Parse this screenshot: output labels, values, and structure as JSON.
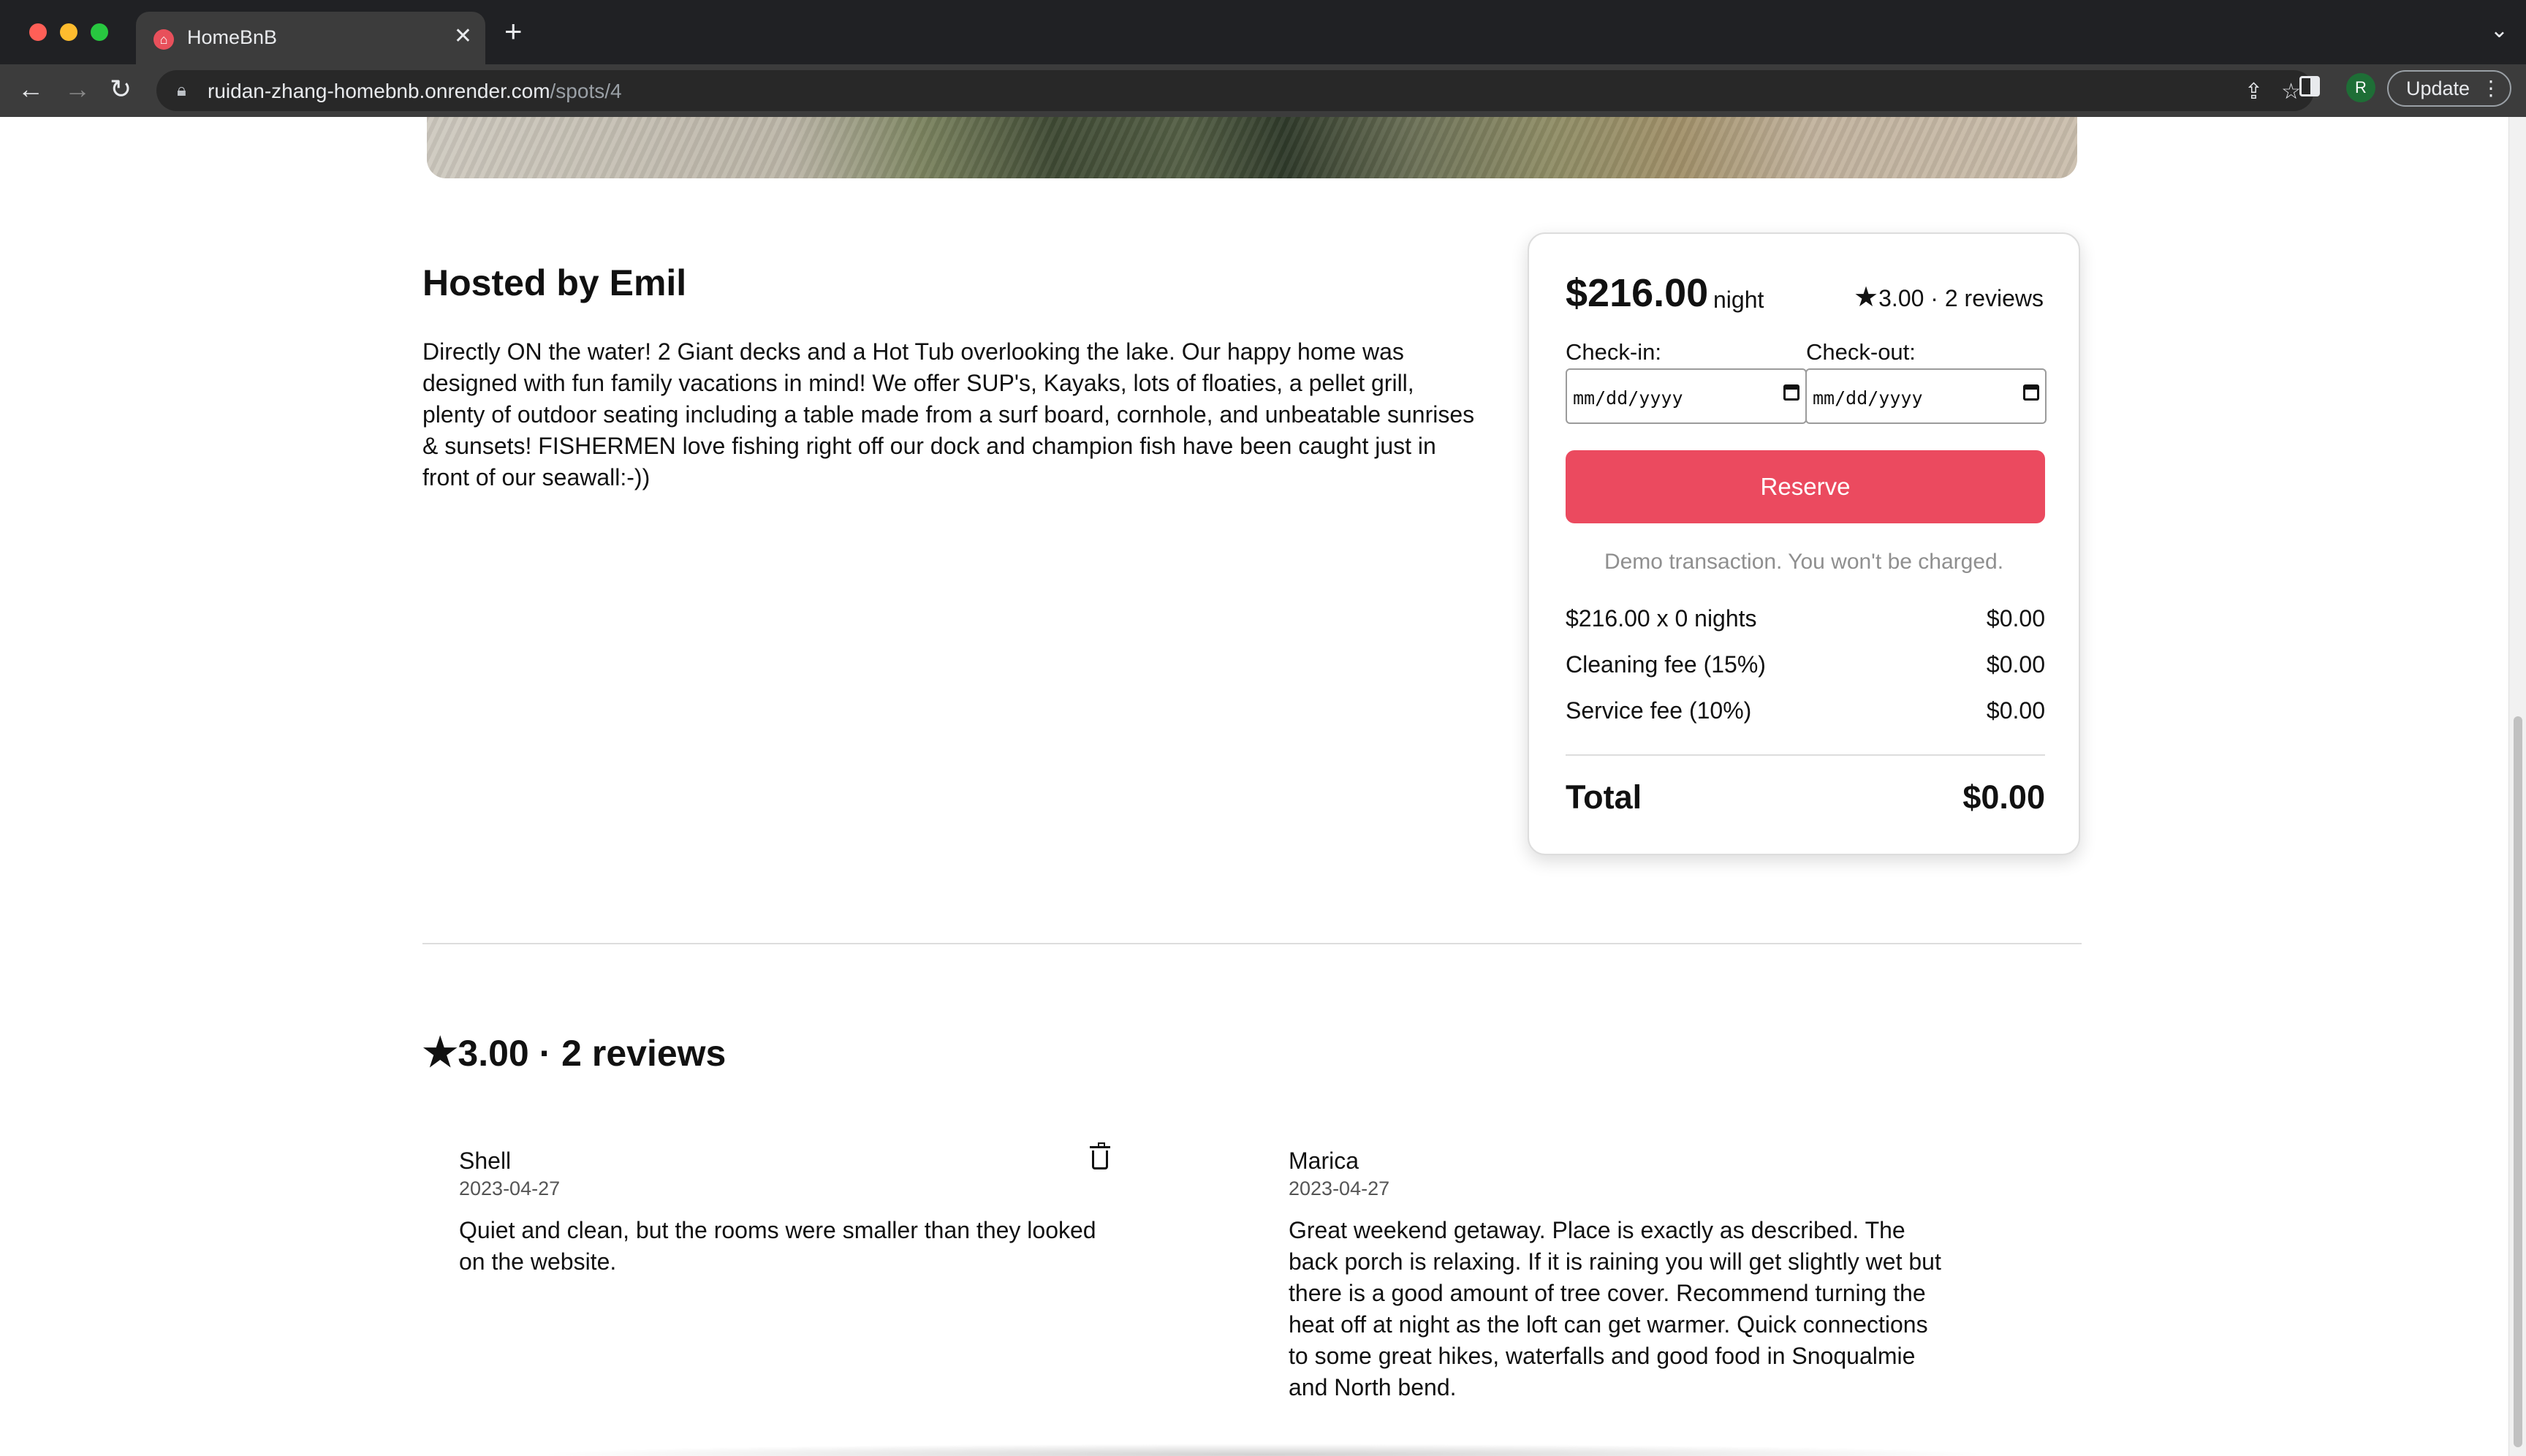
{
  "browser": {
    "tab_title": "HomeBnB",
    "url_host": "ruidan-zhang-homebnb.onrender.com",
    "url_path": "/spots/4",
    "profile_initial": "R",
    "update_label": "Update"
  },
  "listing": {
    "host_title": "Hosted by Emil",
    "description": "Directly ON the water! 2 Giant decks and a Hot Tub overlooking the lake. Our happy home was designed with fun family vacations in mind! We offer SUP's, Kayaks, lots of floaties, a pellet grill, plenty of outdoor seating including a table made from a surf board, cornhole, and unbeatable sunrises & sunsets! FISHERMEN love fishing right off our dock and champion fish have been caught just in front of our seawall:-))"
  },
  "booking": {
    "price": "$216.00",
    "per": "night",
    "rating_text": "3.00 · 2 reviews",
    "checkin_label": "Check-in:",
    "checkout_label": "Check-out:",
    "date_placeholder": "mm/dd/yyyy",
    "reserve_label": "Reserve",
    "demo_note": "Demo transaction. You won't be charged.",
    "fees": [
      {
        "label": "$216.00 x 0 nights",
        "amount": "$0.00"
      },
      {
        "label": "Cleaning fee (15%)",
        "amount": "$0.00"
      },
      {
        "label": "Service fee (10%)",
        "amount": "$0.00"
      }
    ],
    "total_label": "Total",
    "total_amount": "$0.00"
  },
  "reviews": {
    "heading": "3.00 · 2 reviews",
    "items": [
      {
        "name": "Shell",
        "date": "2023-04-27",
        "text": "Quiet and clean, but the rooms were smaller than they looked on the website."
      },
      {
        "name": "Marica",
        "date": "2023-04-27",
        "text": "Great weekend getaway. Place is exactly as described. The back porch is relaxing. If it is raining you will get slightly wet but there is a good amount of tree cover. Recommend turning the heat off at night as the loft can get warmer. Quick connections to some great hikes, waterfalls and good food in Snoqualmie and North bend."
      }
    ]
  },
  "colors": {
    "accent": "#eb4a5f",
    "chrome_dark": "#202124"
  }
}
